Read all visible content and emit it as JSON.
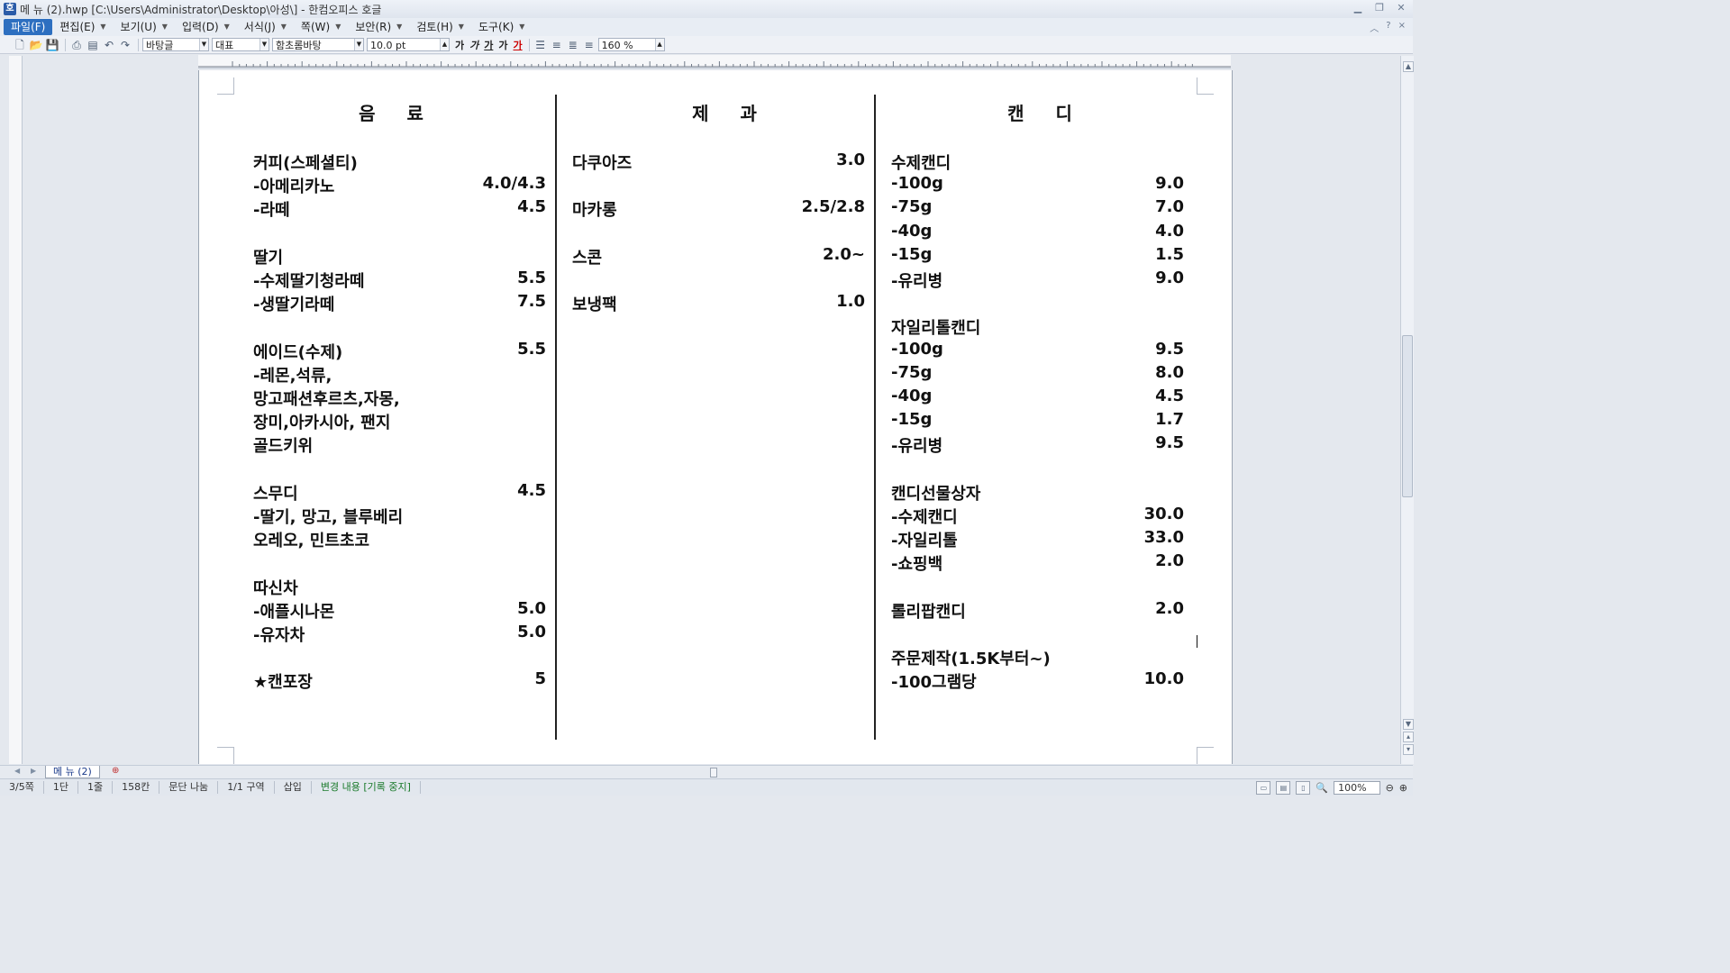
{
  "window": {
    "title": "메 뉴 (2).hwp [C:\\Users\\Administrator\\Desktop\\아성\\] - 한컴오피스 호글",
    "logo": "호"
  },
  "menu": [
    {
      "label": "파일(F)",
      "active": true
    },
    {
      "label": "편집(E)"
    },
    {
      "label": "보기(U)"
    },
    {
      "label": "입력(D)"
    },
    {
      "label": "서식(J)"
    },
    {
      "label": "쪽(W)"
    },
    {
      "label": "보안(R)"
    },
    {
      "label": "검토(H)"
    },
    {
      "label": "도구(K)"
    }
  ],
  "toolbar": {
    "style": "바탕글",
    "rep": "대표",
    "font": "함초롬바탕",
    "size": "10.0",
    "unit": "pt",
    "zoom": "160 %",
    "bold": "가",
    "italic": "가",
    "underline": "가",
    "strike": "가",
    "color": "가"
  },
  "columns": {
    "drinks": "음 료",
    "bakery": "제 과",
    "candy": "캔 디"
  },
  "drinks": [
    {
      "name": "커피(스페셜티)",
      "price": ""
    },
    {
      "name": "-아메리카노",
      "price": "4.0/4.3"
    },
    {
      "name": "-라떼",
      "price": "4.5"
    },
    {
      "name": "딸기",
      "price": ""
    },
    {
      "name": "-수제딸기청라떼",
      "price": "5.5"
    },
    {
      "name": "-생딸기라떼",
      "price": "7.5"
    },
    {
      "name": "에이드(수제)",
      "price": "5.5"
    },
    {
      "name": "-레몬,석류,",
      "price": ""
    },
    {
      "name": " 망고패션후르츠,자몽,",
      "price": ""
    },
    {
      "name": " 장미,아카시아, 팬지",
      "price": ""
    },
    {
      "name": " 골드키위",
      "price": ""
    },
    {
      "name": "스무디",
      "price": "4.5"
    },
    {
      "name": "-딸기, 망고, 블루베리",
      "price": ""
    },
    {
      "name": " 오레오, 민트초코",
      "price": ""
    },
    {
      "name": "따신차",
      "price": ""
    },
    {
      "name": "-애플시나몬",
      "price": "5.0"
    },
    {
      "name": "-유자차",
      "price": "5.0"
    },
    {
      "name": " ★캔포장",
      "price": "5"
    }
  ],
  "bakery": [
    {
      "name": "다쿠아즈",
      "price": "3.0"
    },
    {
      "name": "마카롱",
      "price": "2.5/2.8"
    },
    {
      "name": "스콘",
      "price": "2.0~"
    },
    {
      "name": "보냉팩",
      "price": "1.0"
    }
  ],
  "candy": [
    {
      "name": "수제캔디",
      "price": ""
    },
    {
      "name": "-100g",
      "price": "9.0"
    },
    {
      "name": "-75g",
      "price": "7.0"
    },
    {
      "name": "-40g",
      "price": "4.0"
    },
    {
      "name": "-15g",
      "price": "1.5"
    },
    {
      "name": "-유리병",
      "price": "9.0"
    },
    {
      "name": "자일리톨캔디",
      "price": ""
    },
    {
      "name": "-100g",
      "price": "9.5"
    },
    {
      "name": "-75g",
      "price": "8.0"
    },
    {
      "name": "-40g",
      "price": "4.5"
    },
    {
      "name": "-15g",
      "price": "1.7"
    },
    {
      "name": "-유리병",
      "price": "9.5"
    },
    {
      "name": "캔디선물상자",
      "price": ""
    },
    {
      "name": "-수제캔디",
      "price": "30.0"
    },
    {
      "name": "-자일리톨",
      "price": "33.0"
    },
    {
      "name": "-쇼핑백",
      "price": "2.0"
    },
    {
      "name": "롤리팝캔디",
      "price": "2.0"
    },
    {
      "name": "주문제작(1.5K부터~)",
      "price": ""
    },
    {
      "name": "-100그램당",
      "price": "10.0"
    }
  ],
  "tabs": {
    "doc": "메 뉴 (2)"
  },
  "status": {
    "page": "3/5쪽",
    "col": "1단",
    "line": "1줄",
    "char": "158칸",
    "para": "문단 나눔",
    "section": "1/1 구역",
    "mode": "삽입",
    "track": "변경 내용 [기록 중지]",
    "zoom": "100%"
  }
}
